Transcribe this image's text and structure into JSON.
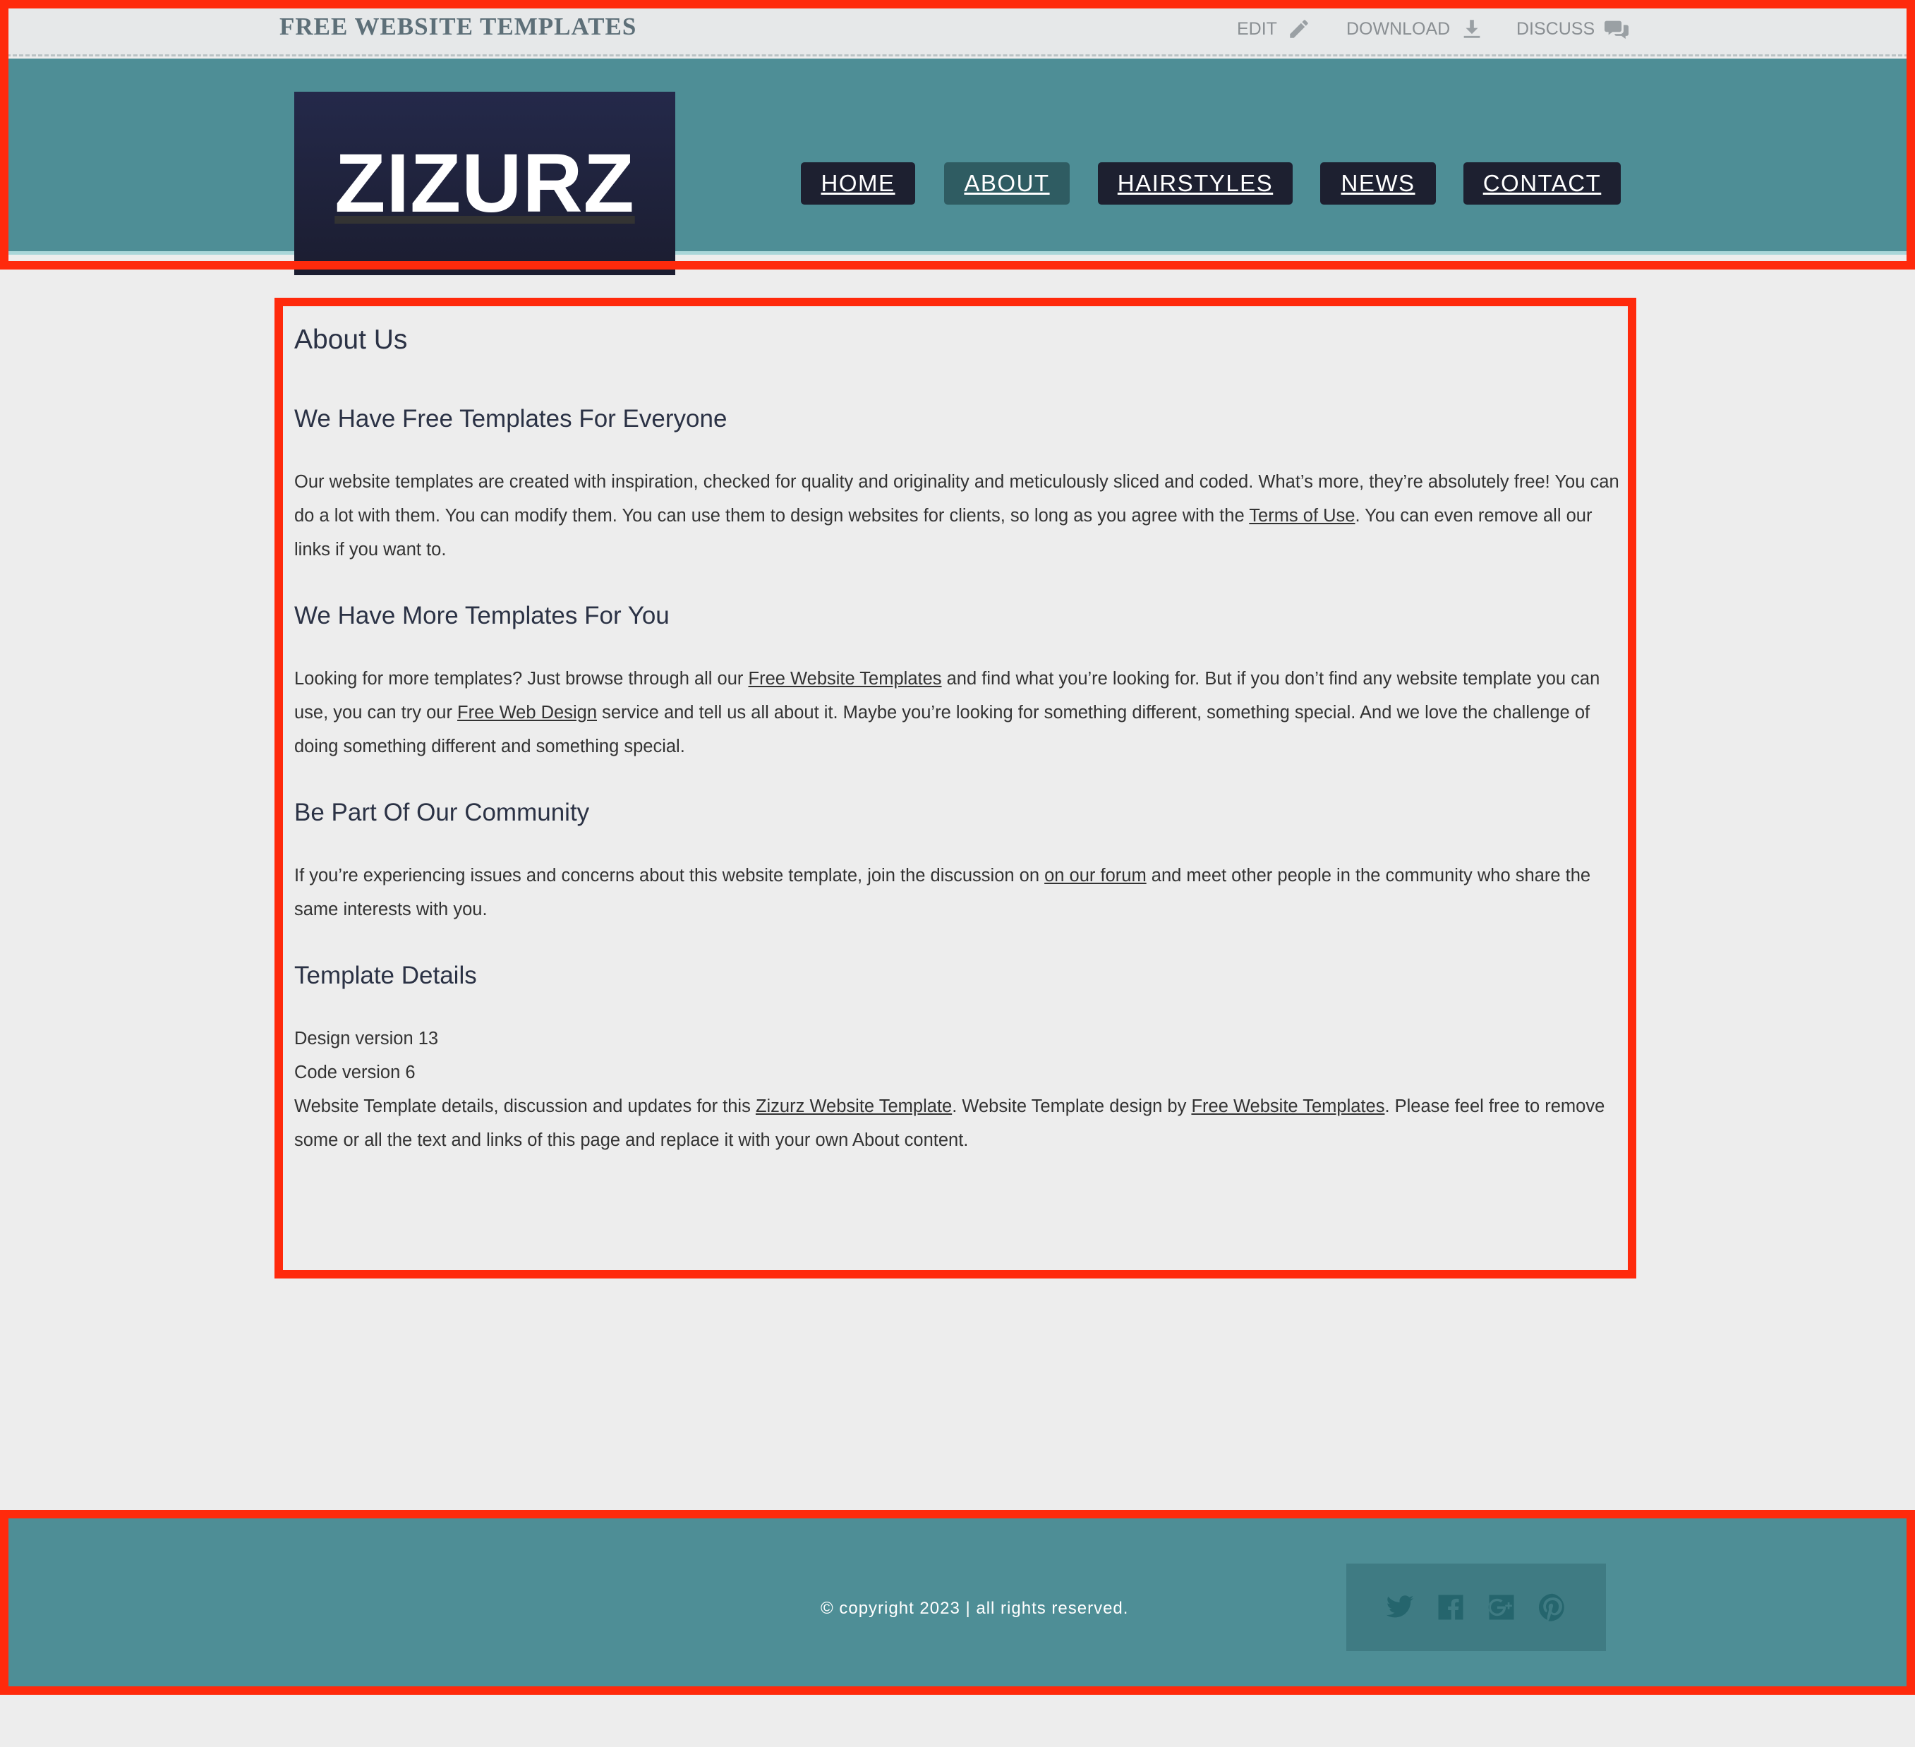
{
  "topbar": {
    "site_label": "FREE WEBSITE TEMPLATES",
    "links": [
      {
        "label": "EDIT",
        "icon": "pencil-icon"
      },
      {
        "label": "DOWNLOAD",
        "icon": "download-icon"
      },
      {
        "label": "DISCUSS",
        "icon": "speech-bubble-icon"
      }
    ]
  },
  "header": {
    "logo": "ZIZURZ",
    "nav": [
      {
        "label": "HOME",
        "active": false
      },
      {
        "label": "ABOUT",
        "active": true
      },
      {
        "label": "HAIRSTYLES",
        "active": false
      },
      {
        "label": "NEWS",
        "active": false
      },
      {
        "label": "CONTACT",
        "active": false
      }
    ]
  },
  "main": {
    "title": "About Us",
    "s1": {
      "heading": "We Have Free Templates For Everyone",
      "t1": "Our website templates are created with inspiration, checked for quality and originality and meticulously sliced and coded. What’s more, they’re absolutely free! You can do a lot with them. You can modify them. You can use them to design websites for clients, so long as you agree with the ",
      "link1": "Terms of Use",
      "t2": ". You can even remove all our links if you want to."
    },
    "s2": {
      "heading": "We Have More Templates For You",
      "t1": "Looking for more templates? Just browse through all our ",
      "link1": "Free Website Templates",
      "t2": " and find what you’re looking for. But if you don’t find any website template you can use, you can try our ",
      "link2": "Free Web Design",
      "t3": " service and tell us all about it. Maybe you’re looking for something different, something special. And we love the challenge of doing something different and something special."
    },
    "s3": {
      "heading": "Be Part Of Our Community",
      "t1": "If you’re experiencing issues and concerns about this website template, join the discussion on ",
      "link1": "on our forum",
      "t2": " and meet other people in the community who share the same interests with you."
    },
    "s4": {
      "heading": "Template Details",
      "design": "Design version 13",
      "code": "Code version 6",
      "t1": "Website Template details, discussion and updates for this ",
      "link1": "Zizurz Website Template",
      "t2": ". Website Template design by ",
      "link2": "Free Website Templates",
      "t3": ". Please feel free to remove some or all the text and links of this page and replace it with your own About content."
    }
  },
  "footer": {
    "copyright": "© copyright 2023 | all rights reserved.",
    "social": [
      "twitter-icon",
      "facebook-icon",
      "google-plus-icon",
      "pinterest-icon"
    ]
  },
  "colors": {
    "header_bg": "#4e8e96",
    "logo_bg": "#1f2238",
    "nav_bg": "#1d2030",
    "nav_active_bg": "#2f5c62",
    "annotation": "#ff2a0c"
  }
}
